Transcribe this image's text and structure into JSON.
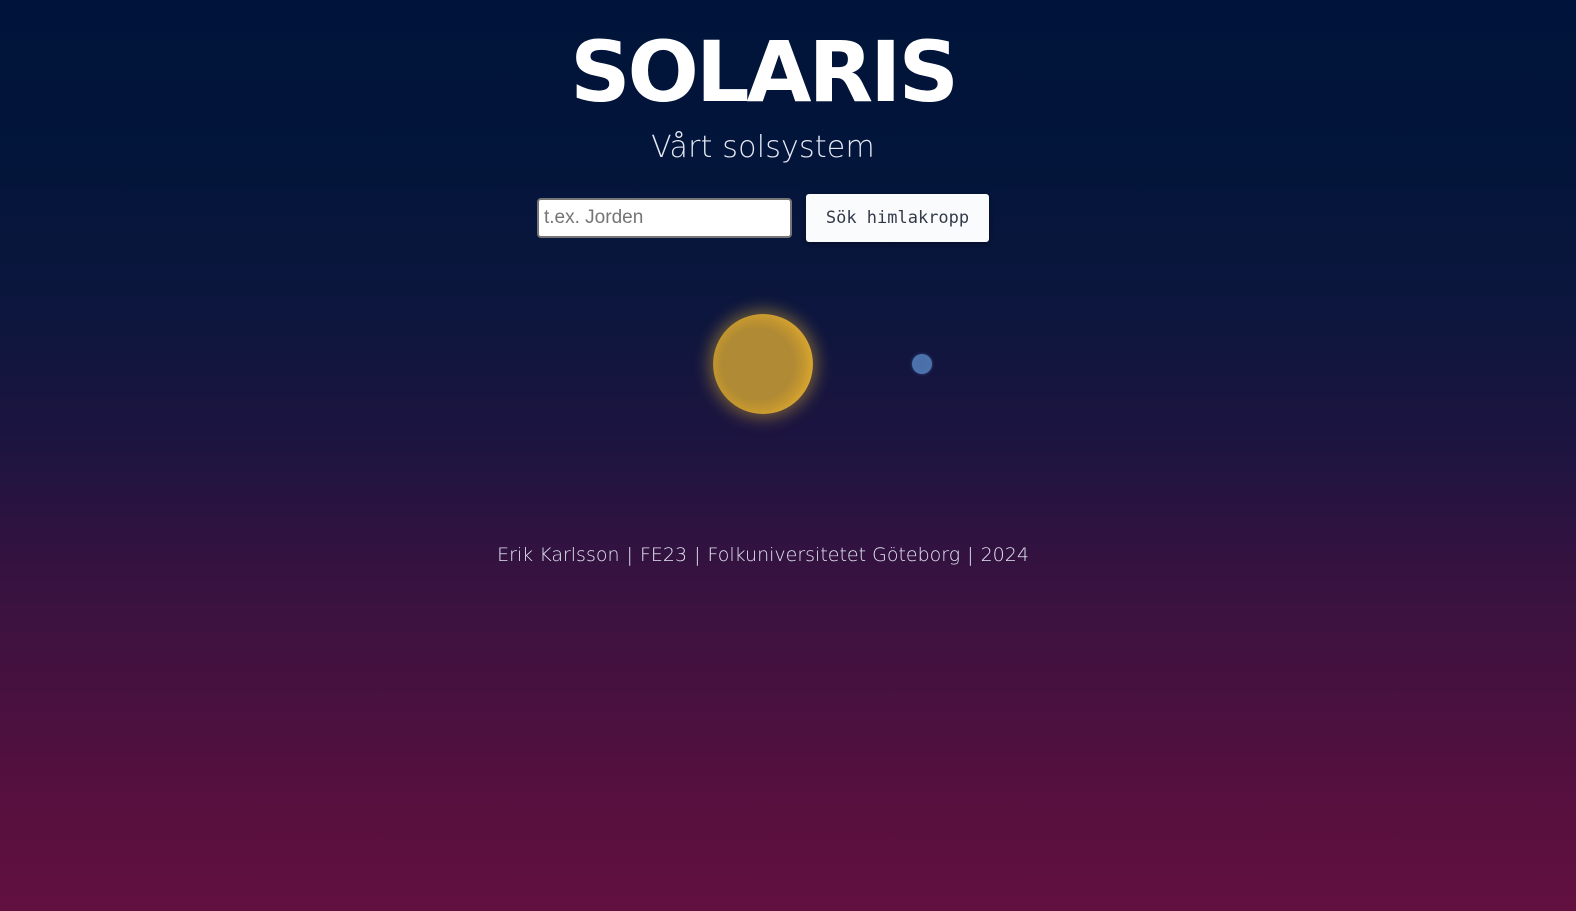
{
  "header": {
    "title": "SOLARIS",
    "subtitle": "Vårt solsystem"
  },
  "search": {
    "placeholder": "t.ex. Jorden",
    "value": "",
    "button_label": "Sök himlakropp"
  },
  "solar_system": {
    "bodies": [
      {
        "name": "sun-icon",
        "color": "#f3c13a"
      },
      {
        "name": "planet-icon",
        "color": "#4b72ad"
      }
    ]
  },
  "footer": {
    "author": "Erik Karlsson",
    "class": "FE23",
    "school": "Folkuniversitetet Göteborg",
    "year": "2024",
    "separator": "|"
  },
  "colors": {
    "background_top": "#00133a",
    "background_bottom": "#621040",
    "sun": "#f3c13a",
    "planet": "#4b72ad"
  }
}
